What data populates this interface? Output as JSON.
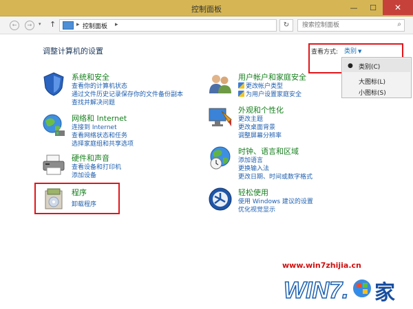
{
  "window": {
    "title": "控制面板",
    "minimize": "—",
    "maximize": "☐",
    "close": "✕"
  },
  "navbar": {
    "back": "←",
    "forward": "→",
    "dropdown": "▾",
    "up": "↑",
    "breadcrumb_sep1": "▸",
    "breadcrumb": "控制面板",
    "breadcrumb_sep2": "▸",
    "address_dropdown": "▾",
    "refresh": "↻",
    "search_placeholder": "搜索控制面板",
    "search_icon": "⌕"
  },
  "main": {
    "heading": "调整计算机的设置",
    "view_by_label": "查看方式:",
    "view_by_value": "类别",
    "view_by_arrow": "▼"
  },
  "view_menu": {
    "selected_marker": "●",
    "items": [
      "类别(C)",
      "大图标(L)",
      "小图标(S)"
    ]
  },
  "categories_left": [
    {
      "title": "系统和安全",
      "links": [
        "查看你的计算机状态",
        "通过文件历史记录保存你的文件备份副本",
        "查找并解决问题"
      ]
    },
    {
      "title": "网络和 Internet",
      "links": [
        "连接到 Internet",
        "查看网络状态和任务",
        "选择家庭组和共享选项"
      ]
    },
    {
      "title": "硬件和声音",
      "links": [
        "查看设备和打印机",
        "添加设备"
      ]
    },
    {
      "title": "程序",
      "links": [
        "卸载程序"
      ]
    }
  ],
  "categories_right": [
    {
      "title": "用户帐户和家庭安全",
      "links": [
        "更改帐户类型",
        "为用户设置家庭安全"
      ]
    },
    {
      "title": "外观和个性化",
      "links": [
        "更改主题",
        "更改桌面背景",
        "调整屏幕分辨率"
      ]
    },
    {
      "title": "时钟、语言和区域",
      "links": [
        "添加语言",
        "更换输入法",
        "更改日期、时间或数字格式"
      ]
    },
    {
      "title": "轻松使用",
      "links": [
        "使用 Windows 建议的设置",
        "优化视觉显示"
      ]
    }
  ],
  "watermark": {
    "url": "www.win7zhijia.cn",
    "logo_text": "WIN7.之家"
  },
  "colors": {
    "titlebar": "#d6b654",
    "category_title": "#157f1c",
    "link": "#1f5fae",
    "highlight_box": "#e0141a"
  }
}
